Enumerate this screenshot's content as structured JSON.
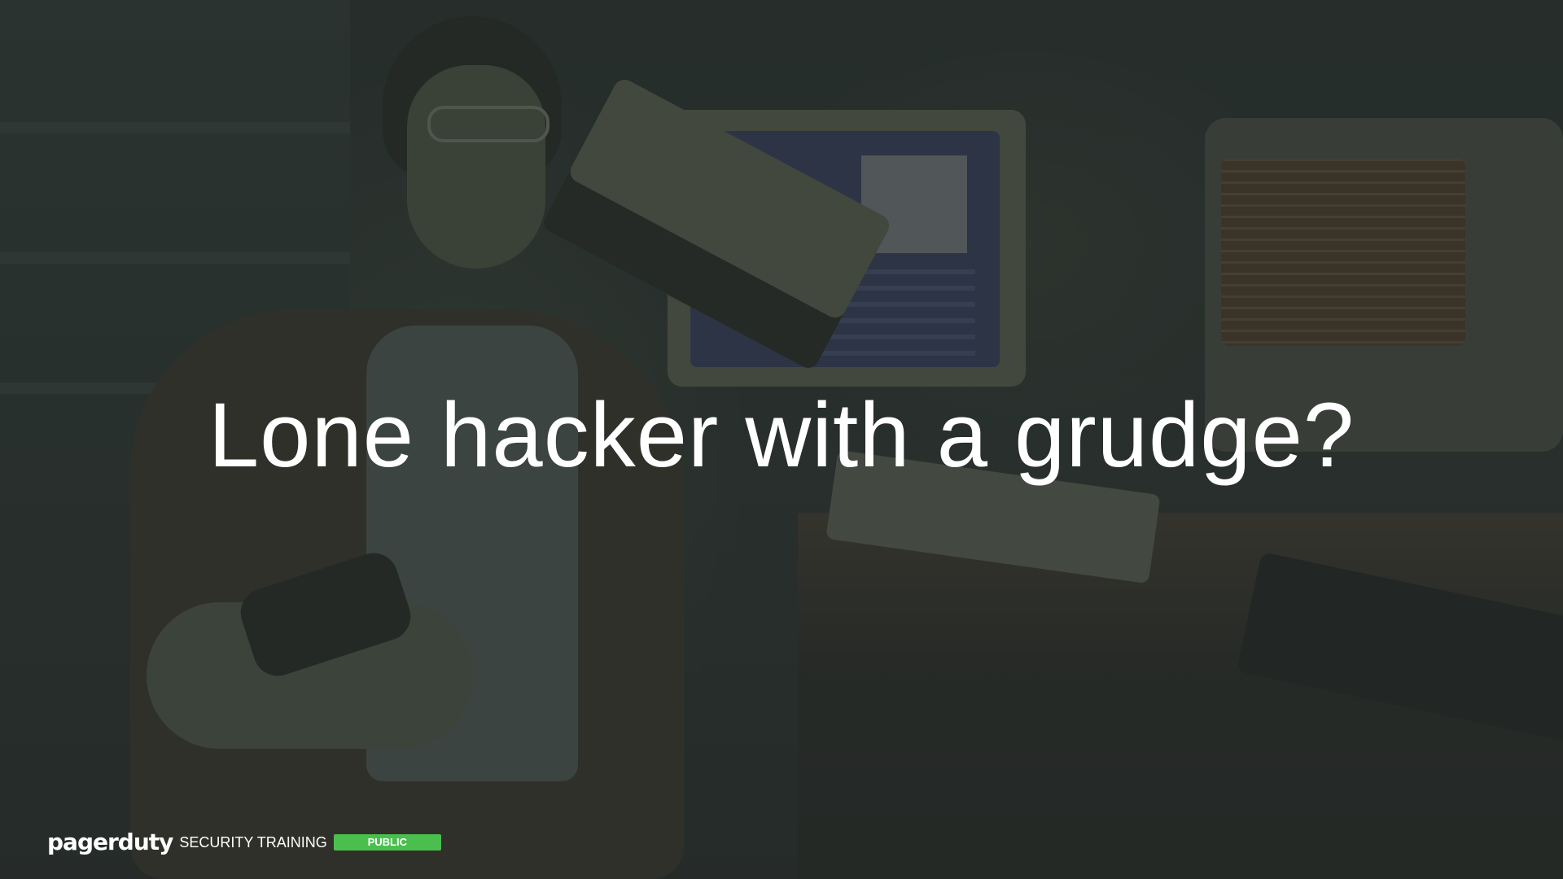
{
  "slide": {
    "title": "Lone hacker with a grudge?"
  },
  "footer": {
    "logo": "pagerduty",
    "label": "SECURITY TRAINING",
    "badge": "PUBLIC",
    "badge_color": "#4bbf4e"
  },
  "background": {
    "description_icon": "photo-hacker-with-retro-computers"
  }
}
